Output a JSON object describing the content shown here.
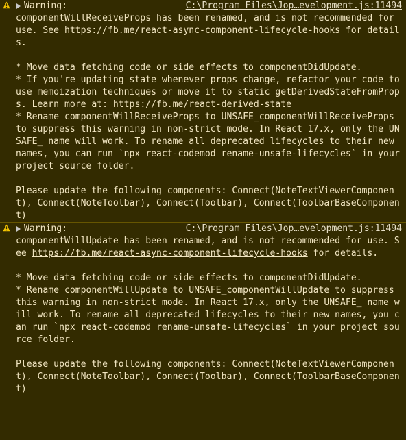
{
  "colors": {
    "background": "#332b00",
    "text": "#f0e4c0",
    "warning_icon": "#f4c400"
  },
  "icons": [
    "warning-triangle-icon",
    "expand-arrow-icon"
  ],
  "messages": [
    {
      "level": "Warning:",
      "source": "C:\\Program Files\\Jop…evelopment.js:11494",
      "intro": "componentWillReceiveProps has been renamed, and is not recommended for use. See ",
      "intro_link": "https://fb.me/react-async-component-lifecycle-hooks",
      "intro_end": " for details.",
      "b1": "* Move data fetching code or side effects to componentDidUpdate.",
      "b2": "* If you're updating state whenever props change, refactor your code to use memoization techniques or move it to static getDerivedStateFromProps. Learn more at: ",
      "b2_link": "https://fb.me/react-derived-state",
      "b3": "* Rename componentWillReceiveProps to UNSAFE_componentWillReceiveProps to suppress this warning in non-strict mode. In React 17.x, only the UNSAFE_ name will work. To rename all deprecated lifecycles to their new names, you can run `npx react-codemod rename-unsafe-lifecycles` in your project source folder.",
      "update": "Please update the following components: Connect(NoteTextViewerComponent), Connect(NoteToolbar), Connect(Toolbar), Connect(ToolbarBaseComponent)"
    },
    {
      "level": "Warning:",
      "source": "C:\\Program Files\\Jop…evelopment.js:11494",
      "intro": "componentWillUpdate has been renamed, and is not recommended for use. See ",
      "intro_link": "https://fb.me/react-async-component-lifecycle-hooks",
      "intro_end": " for details.",
      "b1": "* Move data fetching code or side effects to componentDidUpdate.",
      "b2": "* Rename componentWillUpdate to UNSAFE_componentWillUpdate to suppress this warning in non-strict mode. In React 17.x, only the UNSAFE_ name will work. To rename all deprecated lifecycles to their new names, you can run `npx react-codemod rename-unsafe-lifecycles` in your project source folder.",
      "update": "Please update the following components: Connect(NoteTextViewerComponent), Connect(NoteToolbar), Connect(Toolbar), Connect(ToolbarBaseComponent)"
    }
  ]
}
